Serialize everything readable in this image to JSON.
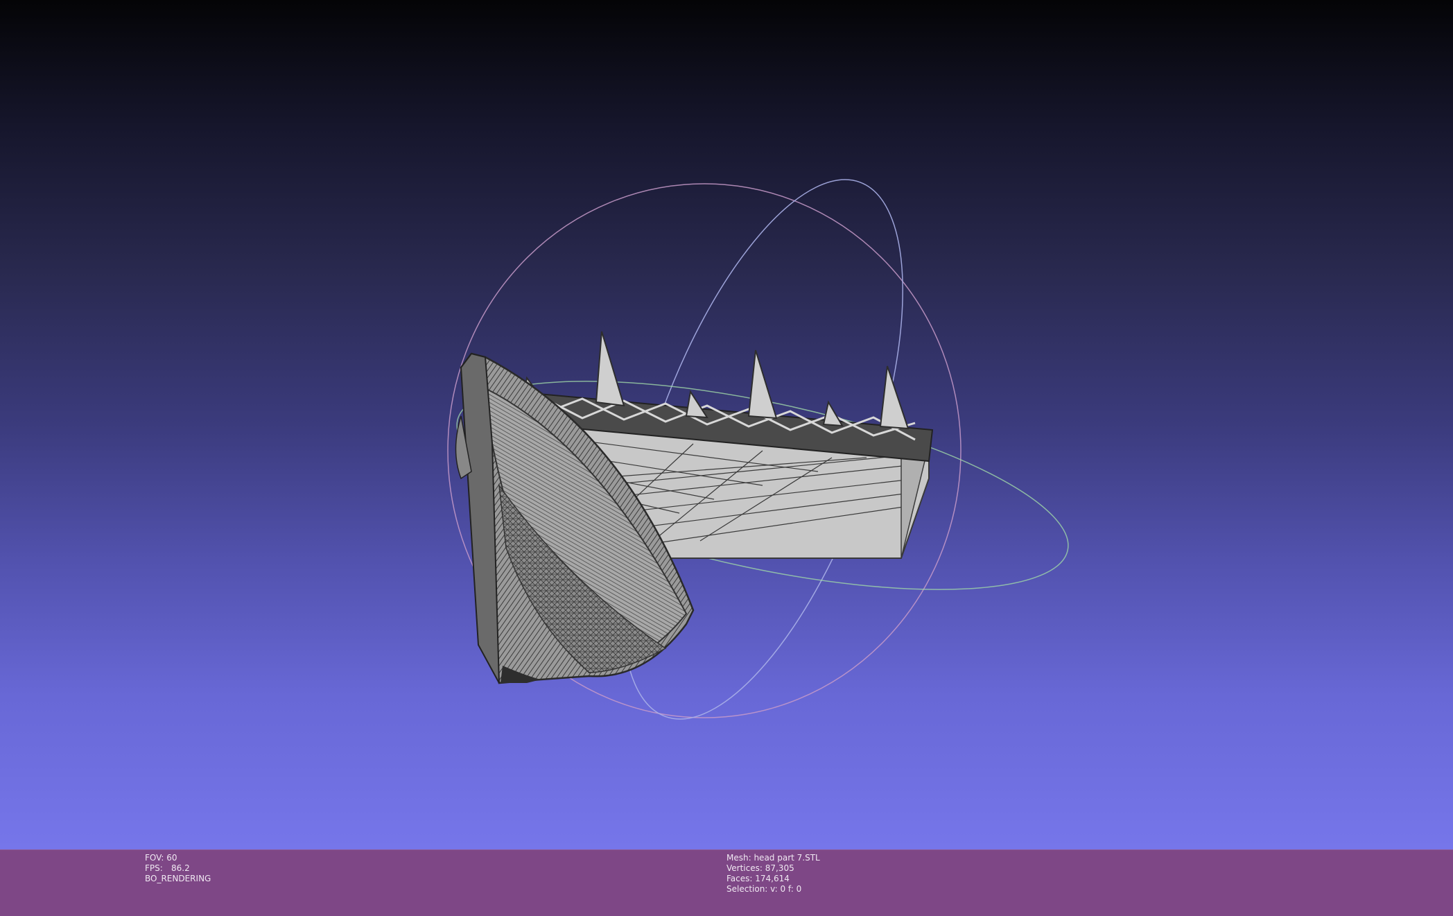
{
  "viewport": {
    "background_top": "#040406",
    "background_bottom": "#7676ea",
    "mesh_fill": "#c8c8c8",
    "wire_color": "#3a3a3a",
    "trackball_colors": [
      "#c79ac9",
      "#aab0e8",
      "#9fd6a8"
    ]
  },
  "status_left": {
    "fov": "FOV: 60",
    "fps_label": "FPS:",
    "fps_value": "86.2",
    "render_mode": "BO_RENDERING"
  },
  "status_right": {
    "mesh": "Mesh: head part 7.STL",
    "vertices": "Vertices: 87,305",
    "faces": "Faces: 174,614",
    "selection": "Selection: v: 0 f: 0"
  },
  "colors": {
    "infobar": "#7e4786",
    "infobar_text": "#f0e8f2"
  }
}
